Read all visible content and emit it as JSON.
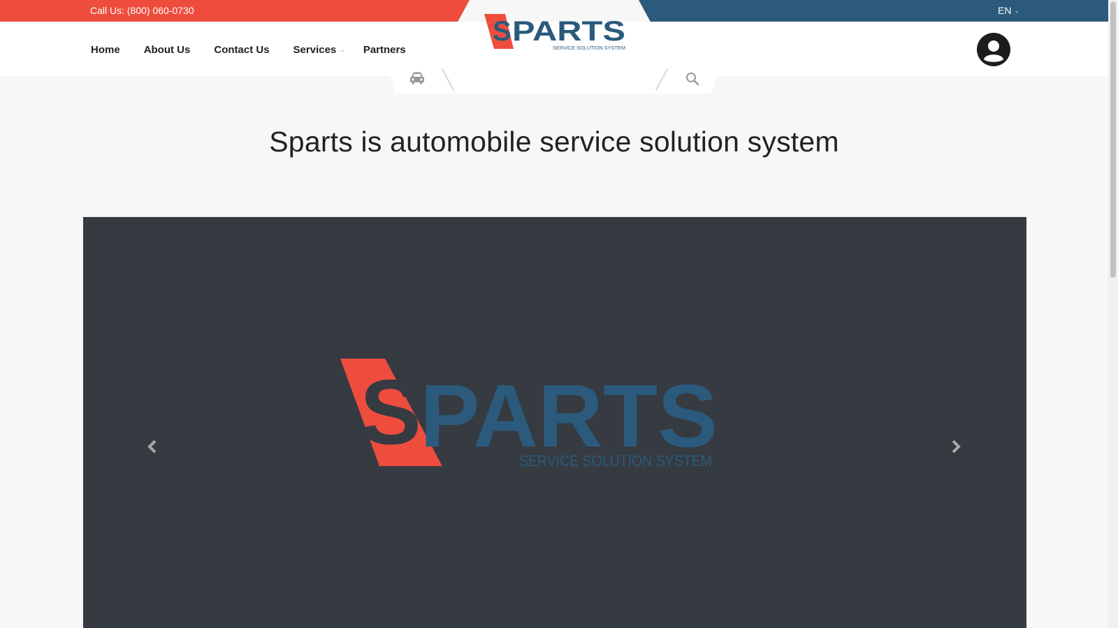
{
  "topbar": {
    "call_us": "Call Us: (800) 060-0730",
    "language": "EN"
  },
  "nav": {
    "items": [
      {
        "label": "Home"
      },
      {
        "label": "About Us"
      },
      {
        "label": "Contact Us"
      },
      {
        "label": "Services",
        "has_dropdown": true
      },
      {
        "label": "Partners"
      }
    ]
  },
  "logo": {
    "mark": "S",
    "word": "PARTS",
    "tagline": "SERVICE SOLUTION SYSTEM"
  },
  "search": {
    "placeholder": "",
    "value": "",
    "vehicle_icon": "car-icon",
    "submit_icon": "search-icon"
  },
  "main": {
    "headline": "Sparts is automobile service solution system"
  },
  "carousel": {
    "prev_icon": "chevron-left-icon",
    "next_icon": "chevron-right-icon"
  },
  "colors": {
    "brand_red": "#ee4d3e",
    "brand_blue": "#2b5a7c",
    "carousel_bg": "#363a41"
  }
}
